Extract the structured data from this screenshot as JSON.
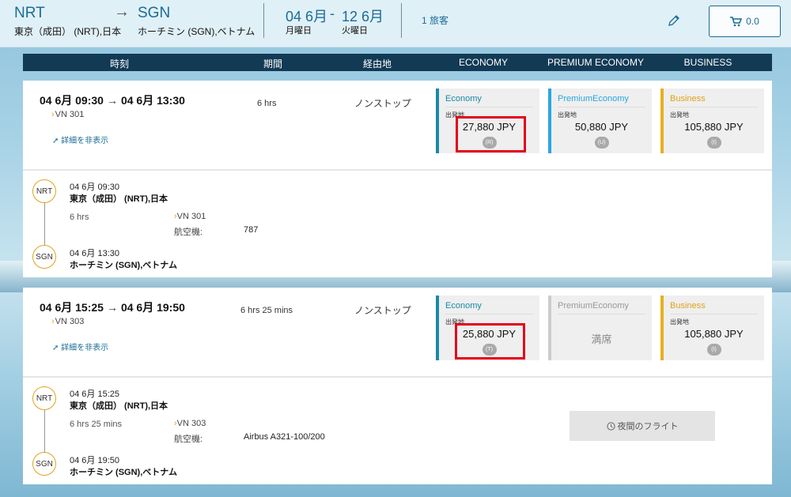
{
  "header": {
    "origin_code": "NRT",
    "origin_city": "東京（成田） (NRT),日本",
    "dest_code": "SGN",
    "dest_city": "ホーチミン (SGN),ベトナム",
    "depart_date": "04 6月",
    "depart_day": "月曜日",
    "return_date": "12 6月",
    "return_day": "火曜日",
    "date_dash": "-",
    "arrow": "→",
    "passengers": "1 旅客",
    "cart_total": "0.0"
  },
  "columns": [
    "時刻",
    "期間",
    "経由地",
    "ECONOMY",
    "PREMIUM ECONOMY",
    "BUSINESS"
  ],
  "flights": [
    {
      "dep": "04 6月 09:30",
      "arr": "04 6月 13:30",
      "flight_no": "VN 301",
      "toggle_label": "詳細を非表示",
      "duration": "6 hrs",
      "stops": "ノンストップ",
      "fares": {
        "economy": {
          "name": "Economy",
          "from_label": "出発地",
          "price": "27,880 JPY",
          "class": "(R)"
        },
        "premium": {
          "name": "PremiumEconomy",
          "from_label": "出発地",
          "price": "50,880 JPY",
          "class": "(U)"
        },
        "business": {
          "name": "Business",
          "from_label": "出発地",
          "price": "105,880 JPY",
          "class": "(I)"
        }
      },
      "detail": {
        "origin_node": "NRT",
        "dest_node": "SGN",
        "dep_time": "04 6月 09:30",
        "origin_city": "東京（成田） (NRT),日本",
        "duration": "6 hrs",
        "flight_no": "VN 301",
        "aircraft_label": "航空機:",
        "aircraft": "787",
        "arr_time": "04 6月 13:30",
        "dest_city": "ホーチミン (SGN),ベトナム"
      }
    },
    {
      "dep": "04 6月 15:25",
      "arr": "04 6月 19:50",
      "flight_no": "VN 303",
      "toggle_label": "詳細を非表示",
      "duration": "6 hrs 25 mins",
      "stops": "ノンストップ",
      "fares": {
        "economy": {
          "name": "Economy",
          "from_label": "出発地",
          "price": "25,880 JPY",
          "class": "(T)"
        },
        "premium": {
          "name": "PremiumEconomy",
          "sold_out": "満席"
        },
        "business": {
          "name": "Business",
          "from_label": "出発地",
          "price": "105,880 JPY",
          "class": "(I)"
        }
      },
      "detail": {
        "origin_node": "NRT",
        "dest_node": "SGN",
        "dep_time": "04 6月 15:25",
        "origin_city": "東京（成田） (NRT),日本",
        "duration": "6 hrs 25 mins",
        "flight_no": "VN 303",
        "aircraft_label": "航空機:",
        "aircraft": "Airbus A321-100/200",
        "arr_time": "04 6月 19:50",
        "dest_city": "ホーチミン (SGN),ベトナム",
        "night_flight": "夜間のフライト"
      }
    }
  ],
  "colors": {
    "accent": "#1a6c96",
    "header_bar": "#123a55",
    "economy": "#1a8aa8",
    "premium": "#2aa7e0",
    "business": "#e8b020",
    "highlight": "#e4001b"
  }
}
